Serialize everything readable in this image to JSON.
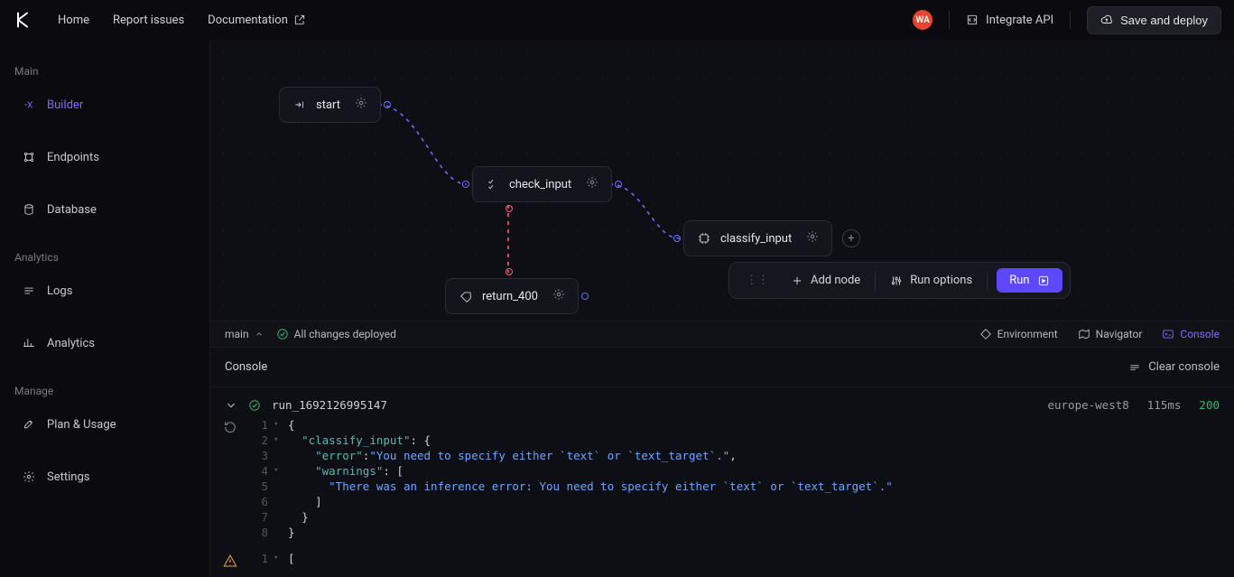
{
  "topbar": {
    "nav": {
      "home": "Home",
      "report": "Report issues",
      "docs": "Documentation"
    },
    "avatar_initials": "WA",
    "integrate": "Integrate API",
    "save": "Save and deploy"
  },
  "sidebar": {
    "sections": {
      "main": {
        "title": "Main",
        "builder": "Builder",
        "endpoints": "Endpoints",
        "database": "Database"
      },
      "analytics": {
        "title": "Analytics",
        "logs": "Logs",
        "analytics": "Analytics"
      },
      "manage": {
        "title": "Manage",
        "plan": "Plan & Usage",
        "settings": "Settings"
      }
    }
  },
  "canvas": {
    "nodes": {
      "start": "start",
      "check_input": "check_input",
      "classify_input": "classify_input",
      "return_400": "return_400"
    },
    "action_bar": {
      "add_node": "Add node",
      "run_options": "Run options",
      "run": "Run"
    }
  },
  "status": {
    "branch": "main",
    "deploy_state": "All changes deployed",
    "tabs": {
      "environment": "Environment",
      "navigator": "Navigator",
      "console": "Console"
    }
  },
  "console": {
    "title": "Console",
    "clear": "Clear console",
    "run": {
      "id": "run_1692126995147",
      "region": "europe-west8",
      "latency": "115ms",
      "status_code": "200"
    },
    "code": {
      "l1": "{",
      "l2_key": "\"classify_input\"",
      "l2_rest": ": {",
      "l3_key": "\"error\"",
      "l3_colon": ": ",
      "l3_val": "\"You need to specify either `text` or `text_target`.\"",
      "l3_comma": ",",
      "l4_key": "\"warnings\"",
      "l4_rest": ": [",
      "l5_val": "\"There was an inference error: You need to specify either `text` or `text_target`.\"",
      "l6": "]",
      "l7": "}",
      "l8": "}",
      "warn_l1": "["
    }
  }
}
